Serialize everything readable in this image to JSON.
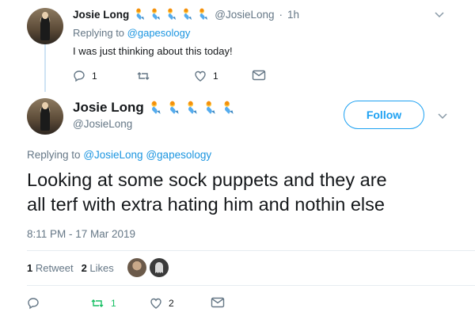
{
  "reply_tweet": {
    "display_name": "Josie Long",
    "emoji_icons": [
      "mermaid-icon",
      "mermaid-icon",
      "mermaid-icon",
      "mermaid-icon",
      "mermaid-icon"
    ],
    "handle": "@JosieLong",
    "separator": "·",
    "time": "1h",
    "replying_to_prefix": "Replying to",
    "replying_to_handle": "@gapesology",
    "text": "I was just thinking about this today!",
    "actions": {
      "reply_count": "1",
      "retweet_count": "",
      "like_count": "1"
    }
  },
  "main_tweet": {
    "display_name": "Josie Long",
    "emoji_icons": [
      "mermaid-icon",
      "mermaid-icon",
      "mermaid-icon",
      "mermaid-icon",
      "mermaid-icon"
    ],
    "handle": "@JosieLong",
    "follow_label": "Follow",
    "replying_to_prefix": "Replying to",
    "replying_to_handles": [
      "@JosieLong",
      "@gapesology"
    ],
    "text_line1": "Looking at some sock puppets and they are",
    "text_line2": "all terf with extra hating him and nothin else",
    "timestamp": "8:11 PM - 17 Mar 2019",
    "stats": {
      "retweets_count": "1",
      "retweets_label": "Retweet",
      "likes_count": "2",
      "likes_label": "Likes"
    },
    "actions": {
      "reply_count": "",
      "retweet_count": "1",
      "like_count": "2"
    }
  },
  "colors": {
    "link": "#1b95e0",
    "muted": "#657786",
    "retweet_active": "#17bf63",
    "follow": "#1da1f2"
  }
}
